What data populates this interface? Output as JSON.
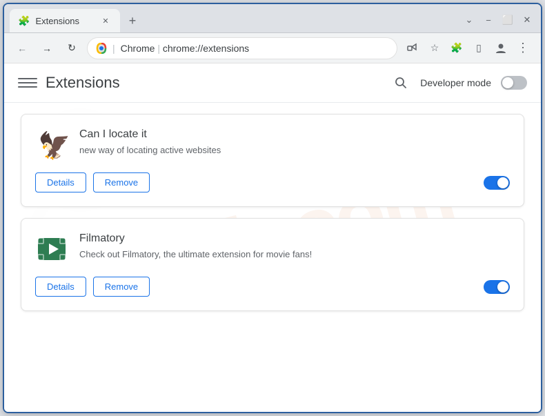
{
  "window": {
    "title": "Extensions",
    "tab_label": "Extensions",
    "url_brand": "Chrome",
    "url_path": "chrome://extensions",
    "window_controls": {
      "minimize": "−",
      "maximize": "⬜",
      "close": "✕",
      "restore_down": "⌄"
    }
  },
  "toolbar": {
    "back_label": "←",
    "forward_label": "→",
    "reload_label": "↻",
    "new_tab_label": "+"
  },
  "extensions_page": {
    "title": "Extensions",
    "dev_mode_label": "Developer mode",
    "dev_mode_on": false,
    "watermark": "riash.com"
  },
  "extensions": [
    {
      "name": "Can I locate it",
      "description": "new way of locating active websites",
      "details_label": "Details",
      "remove_label": "Remove",
      "enabled": true
    },
    {
      "name": "Filmatory",
      "description": "Check out Filmatory, the ultimate extension for movie fans!",
      "details_label": "Details",
      "remove_label": "Remove",
      "enabled": true
    }
  ]
}
